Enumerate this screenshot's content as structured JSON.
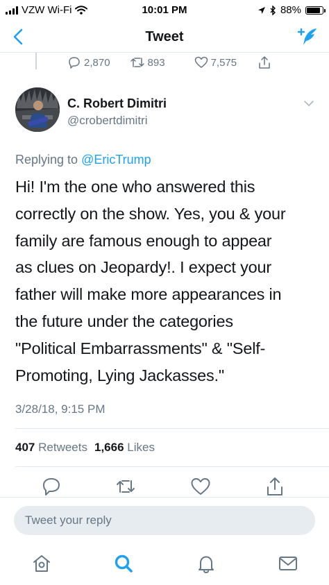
{
  "status_bar": {
    "carrier": "VZW Wi-Fi",
    "time": "10:01 PM",
    "battery": "88%",
    "battery_level": 0.88
  },
  "nav": {
    "title": "Tweet",
    "back_icon": "chevron-left-icon",
    "compose_icon": "compose-tweet-icon"
  },
  "previous_tweet": {
    "replies": "2,870",
    "retweets": "893",
    "likes": "7,575"
  },
  "tweet": {
    "author_name": "C. Robert Dimitri",
    "author_handle": "@crobertdimitri",
    "replying_prefix": "Replying to",
    "replying_to": "@EricTrump",
    "body_lines": [
      "Hi! I'm the one who answered this",
      "correctly on the show. Yes, you & your",
      "family are famous enough to appear",
      "as clues on Jeopardy!. I expect your",
      "father will make more appearances in",
      "the future under the categories",
      "\"Political Embarrassments\" & \"Self-",
      "Promoting, Lying Jackasses.\""
    ],
    "timestamp": "3/28/18, 9:15 PM",
    "retweet_count": "407",
    "retweet_label": "Retweets",
    "like_count": "1,666",
    "like_label": "Likes"
  },
  "reply_box": {
    "placeholder": "Tweet your reply"
  },
  "tabbar": {
    "icons": [
      "home-icon",
      "search-icon",
      "notifications-icon",
      "messages-icon"
    ],
    "active": "search-icon"
  },
  "colors": {
    "accent": "#1da1f2",
    "secondary_text": "#657786",
    "primary_text": "#14171a",
    "divider": "#e1e8ed"
  }
}
